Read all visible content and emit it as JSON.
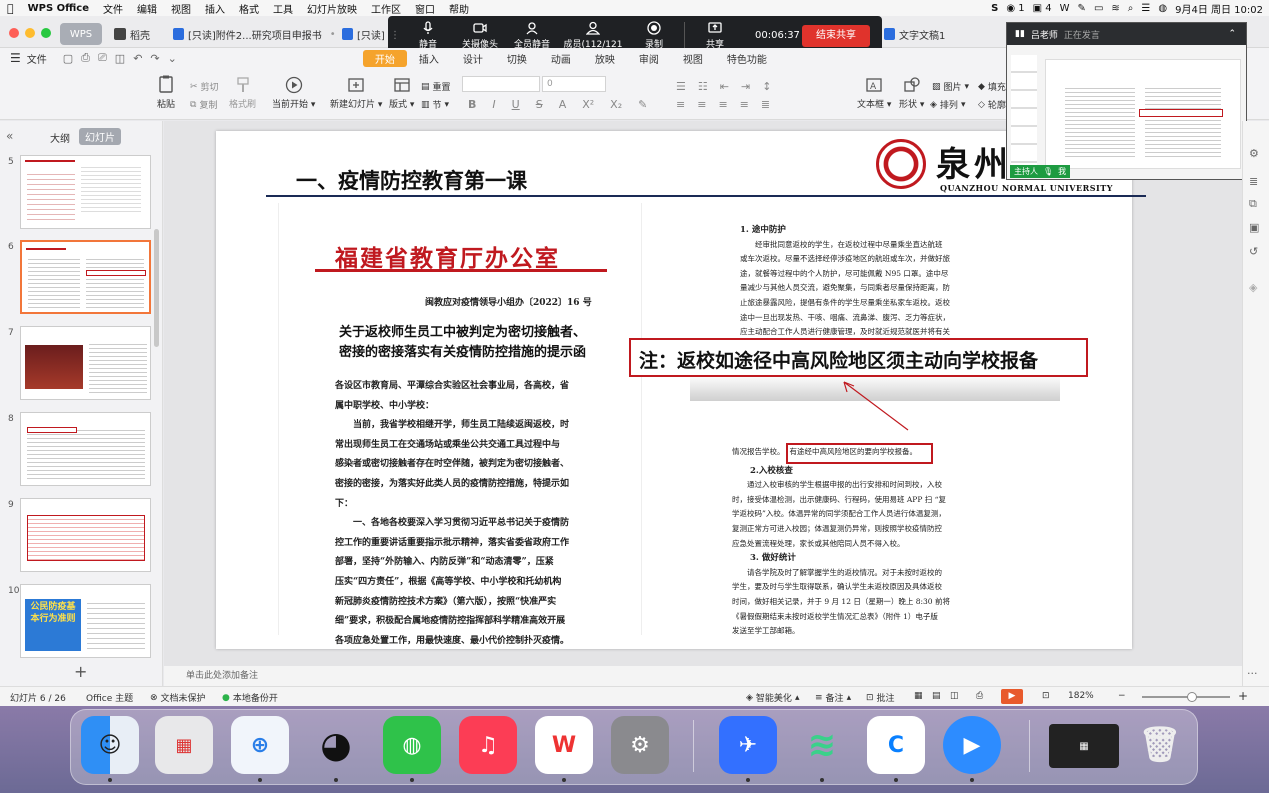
{
  "menubar": {
    "app": "WPS Office",
    "items": [
      "文件",
      "编辑",
      "视图",
      "插入",
      "格式",
      "工具",
      "幻灯片放映",
      "工作区",
      "窗口",
      "帮助"
    ],
    "right_items": [
      "1",
      "4"
    ],
    "datetime": "9月4日 周日 10:02"
  },
  "tabs": {
    "home": "WPS",
    "daoke": "稻壳",
    "doc1": "[只读]附件2...研究项目申报书",
    "doc2": "[只读]",
    "doc3": "文字文稿1"
  },
  "meeting": {
    "mute": "静音",
    "camera": "关摄像头",
    "mute_all": "全员静音",
    "members": "成员(112/121",
    "record": "录制",
    "share": "共享",
    "timer": "00:06:37",
    "end": "结束共享"
  },
  "menurow": {
    "file": "文件",
    "tabs": [
      "开始",
      "插入",
      "设计",
      "切换",
      "动画",
      "放映",
      "审阅",
      "视图",
      "特色功能"
    ]
  },
  "ribbon": {
    "paste": "粘贴",
    "cut": "剪切",
    "copy": "复制",
    "format_painter": "格式刷",
    "from_current": "当前开始",
    "new_slide": "新建幻灯片",
    "layout": "版式",
    "section": "节",
    "reset": "重置",
    "font_size": "0",
    "textbox": "文本框",
    "shape": "形状",
    "arrange": "排列",
    "picture": "图片",
    "fill": "填充",
    "outline": "轮廓"
  },
  "leftpane": {
    "outline": "大纲",
    "slides": "幻灯片",
    "thumbs": [
      "5",
      "6",
      "7",
      "8",
      "9",
      "10"
    ],
    "thumb10_text": "公民防疫基本行为准则"
  },
  "slide": {
    "title": "一、疫情防控教育第一课",
    "logo_cn": "泉州",
    "logo_en": "QUANZHOU  NORMAL  UNIVERSITY",
    "doc_header": "福建省教育厅办公室",
    "doc_no": "闽教应对疫情领导小组办〔2022〕16 号",
    "doc_title1": "关于返校师生员工中被判定为密切接触者、",
    "doc_title2": "密接的密接落实有关疫情防控措施的提示函",
    "lines": [
      "各设区市教育局、平潭综合实验区社会事业局，各高校，省",
      "属中职学校、中小学校：",
      "　　当前，我省学校相继开学，师生员工陆续返闽返校，时",
      "常出现师生员工在交通场站或乘坐公共交通工具过程中与",
      "感染者或密切接触者存在时空伴随，被判定为密切接触者、",
      "密接的密接，为落实好此类人员的疫情防控措施，特提示如",
      "下：",
      "　　一、各地各校要深入学习贯彻习近平总书记关于疫情防",
      "控工作的重要讲话重要指示批示精神，落实省委省政府工作",
      "部署，坚持“外防输入、内防反弹”和“动态清零”，压紧",
      "压实“四方责任”，根据《高等学校、中小学校和托幼机构",
      "新冠肺炎疫情防控技术方案》（第六版），按照“快准严实",
      "细”要求，积极配合属地疫情防控指挥部科学精准高效开展",
      "各项应急处置工作，用最快速度、最小代价控制扑灭疫情。"
    ],
    "r_heading1": "1. 途中防护",
    "r_para1": [
      "　　经审批同意返校的学生，在返校过程中尽量乘坐直达航班",
      "或车次返校。尽量不选择经停涉疫地区的航班或车次，并做好旅",
      "途，就餐等过程中的个人防护，尽可能佩戴 N95 口罩。途中尽",
      "量减少与其他人员交流，避免聚集，与同乘者尽量保持距离，防",
      "止旅途暴露风险，提倡有条件的学生尽量乘坐私家车返校。返校",
      "途中一旦出现发热、干咳、咽痛、流鼻涕、腹泻、乏力等症状，",
      "应主动配合工作人员进行健康管理，及时就近规范就医并将有关"
    ],
    "note": "注：返校如途径中高风险地区须主动向学校报备",
    "r_report_prefix": "情况报告学校。",
    "r_report_box": "有途经中高风险地区的要向学校报备。",
    "r_heading2": "2.入校核查",
    "r_para2": [
      "　　通过入校审核的学生根据申报的出行安排和时间到校，入校",
      "时，接受体温检测，出示健康码、行程码，使用易班 APP 扫 “复",
      "学返校码”入校。体温异常的同学须配合工作人员进行体温复测，",
      "复测正常方可进入校园；体温复测仍异常，则按照学校疫情防控",
      "应急处置流程处理，家长或其他陪同人员不得入校。"
    ],
    "r_heading3": "3. 做好统计",
    "r_para3": [
      "　　请各学院及时了解掌握学生的返校情况。对于未按时返校的",
      "学生，要及时与学生取得联系，确认学生未返校原因及具体返校",
      "时间，做好相关记录，并于 9 月 12 日（星期一）晚上 8:30 前将",
      "《暑假假期结束未按时返校学生情况汇总表》（附件 1）电子版",
      "发送至学工部邮箱。"
    ]
  },
  "notes": "单击此处添加备注",
  "status": {
    "slide_count": "幻灯片 6 / 26",
    "theme": "Office 主题",
    "protect": "文档未保护",
    "backup": "本地备份开",
    "beautify": "智能美化",
    "notes": "备注",
    "comments": "批注",
    "zoom": "182%"
  },
  "video": {
    "speaker": "吕老师",
    "speaking": "正在发言",
    "host": "主持人",
    "me": "我"
  },
  "colors": {
    "accent": "#f5a32c",
    "red": "#c0191f",
    "dock": "#7a6ea0"
  }
}
